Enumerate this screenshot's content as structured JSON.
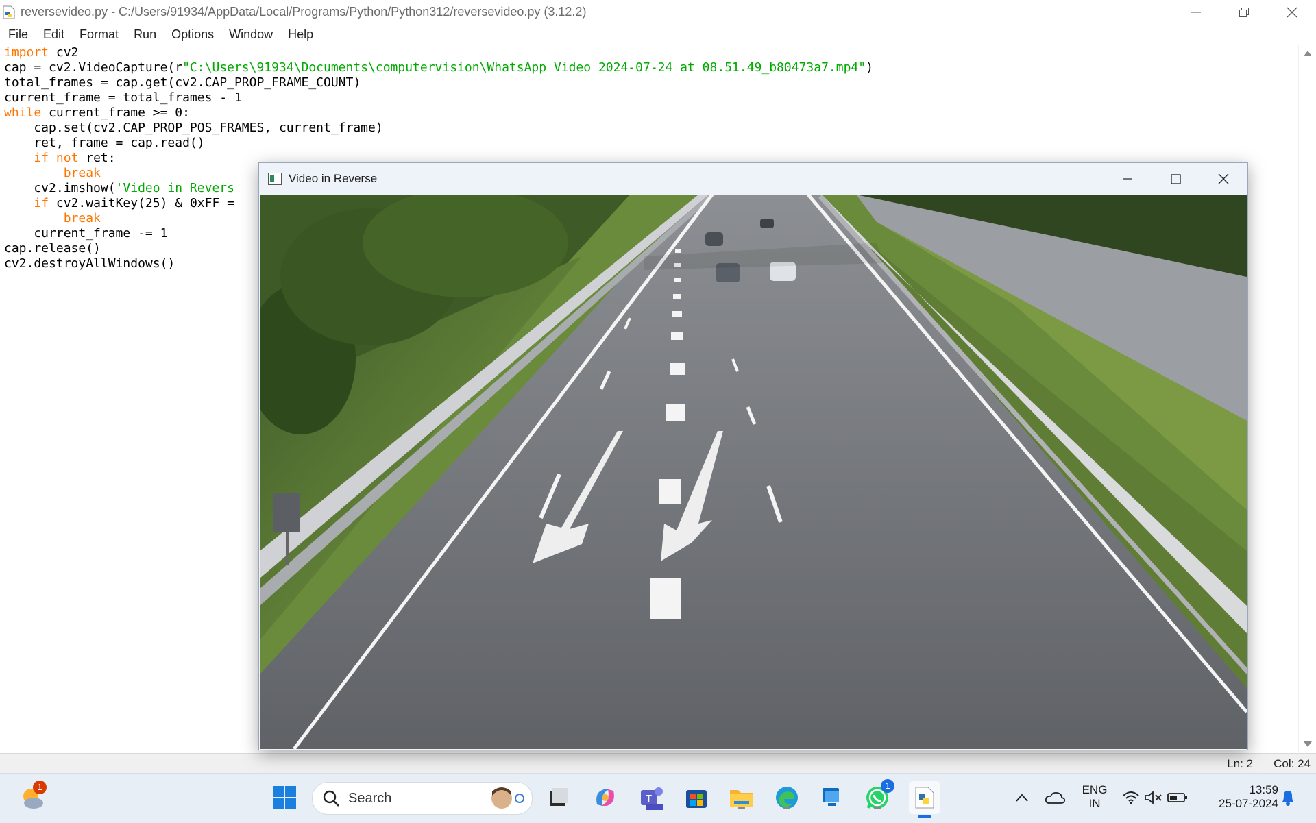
{
  "window": {
    "title": "reversevideo.py - C:/Users/91934/AppData/Local/Programs/Python/Python312/reversevideo.py (3.12.2)"
  },
  "menu": [
    "File",
    "Edit",
    "Format",
    "Run",
    "Options",
    "Window",
    "Help"
  ],
  "code_lines": [
    "import cv2",
    "cap = cv2.VideoCapture(r\"C:\\Users\\91934\\Documents\\computervision\\WhatsApp Video 2024-07-24 at 08.51.49_b80473a7.mp4\")",
    "total_frames = cap.get(cv2.CAP_PROP_FRAME_COUNT)",
    "current_frame = total_frames - 1",
    "while current_frame >= 0:",
    "    cap.set(cv2.CAP_PROP_POS_FRAMES, current_frame)",
    "    ret, frame = cap.read()",
    "    if not ret:",
    "        break",
    "    cv2.imshow('Video in Revers",
    "    if cv2.waitKey(25) & 0xFF =",
    "        break",
    "    current_frame -= 1",
    "cap.release()",
    "cv2.destroyAllWindows()"
  ],
  "status": {
    "line": "Ln: 2",
    "col": "Col: 24"
  },
  "video_window": {
    "title": "Video in Reverse"
  },
  "taskbar": {
    "search_placeholder": "Search",
    "weather_badge": "1",
    "whatsapp_badge": "1",
    "lang_top": "ENG",
    "lang_bottom": "IN",
    "time": "13:59",
    "date": "25-07-2024"
  },
  "colors": {
    "keyword": "#ff7700",
    "string": "#00aa00",
    "taskbar_bg": "#e8eef6",
    "badge": "#d83b01"
  }
}
